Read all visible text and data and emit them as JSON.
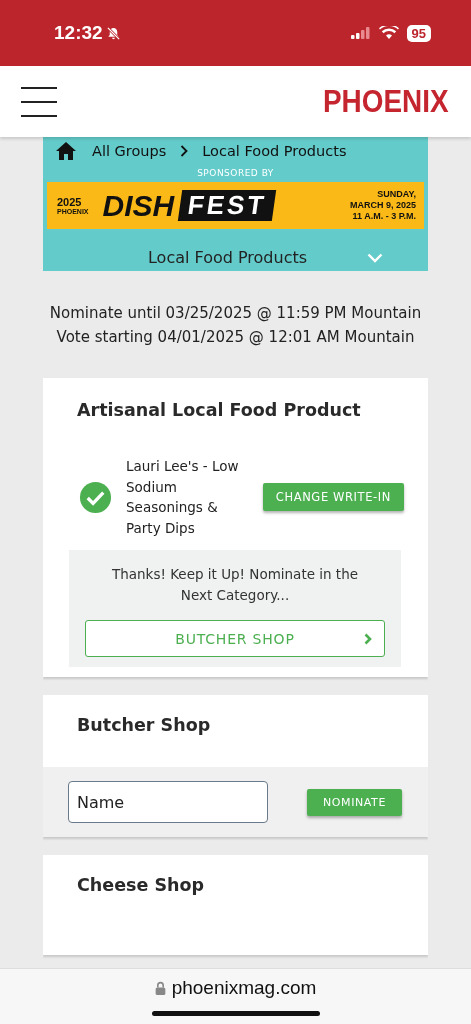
{
  "status_bar": {
    "time": "12:32",
    "muted": true,
    "battery": "95"
  },
  "header": {
    "logo": "PHOENIX"
  },
  "breadcrumb": [
    "All Groups",
    "Local Food Products"
  ],
  "sponsor": {
    "label": "SPONSORED BY",
    "banner": {
      "year": "2025",
      "brand": "PHOENIX",
      "title_1": "DISH",
      "title_2": "FEST",
      "date_lines": [
        "SUNDAY,",
        "MARCH 9, 2025",
        "11 A.M. - 3 P.M."
      ]
    }
  },
  "group_select": {
    "value": "Local Food Products",
    "expanded": false
  },
  "deadlines": [
    "Nominate until 03/25/2025 @ 11:59 PM Mountain",
    "Vote starting 04/01/2025 @ 12:01 AM Mountain"
  ],
  "categories": [
    {
      "kind": "nominated",
      "title": "Artisanal Local Food Product",
      "nominee": "Lauri Lee's - Low Sodium Seasonings & Party Dips",
      "button": "CHANGE WRITE-IN",
      "message": "Thanks! Keep it Up! Nominate in the Next Category...",
      "next_button": "BUTCHER SHOP"
    },
    {
      "kind": "form",
      "title": "Butcher Shop",
      "placeholder": "Name",
      "button": "NOMINATE"
    },
    {
      "kind": "title",
      "title": "Cheese Shop"
    }
  ],
  "browser": {
    "url": "phoenixmag.com"
  }
}
